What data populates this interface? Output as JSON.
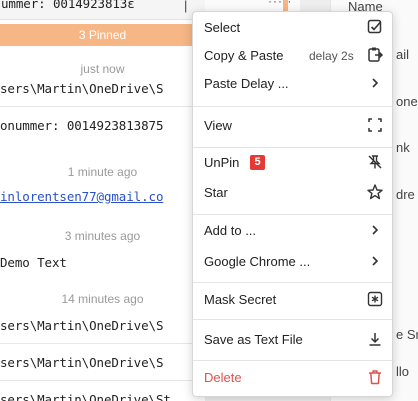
{
  "header": {
    "clip_text": "ummer: 0014923813ε",
    "caret": "|",
    "toolbar_dots": "··· ·"
  },
  "list": {
    "pinned_label": "3 Pinned",
    "items": [
      {
        "time": "just now",
        "text": "sers\\Martin\\OneDrive\\S"
      },
      {
        "text": "onummer: 0014923813875"
      },
      {
        "time": "1 minute ago",
        "text": "inlorentsen77@gmail.co"
      },
      {
        "time": "3 minutes ago",
        "text": " Demo Text"
      },
      {
        "time": "14 minutes ago",
        "text": "sers\\Martin\\OneDrive\\S"
      },
      {
        "text": "sers\\Martin\\OneDrive\\S"
      },
      {
        "text": "sers\\Martin\\OneDrive\\St..."
      }
    ]
  },
  "right_panel": {
    "texts": [
      "Name",
      "ail",
      "one",
      "nk",
      "dre",
      "e Sr",
      "llo"
    ]
  },
  "menu": {
    "items": [
      {
        "label": "Select",
        "icon": "checkbox-checked-icon"
      },
      {
        "label": "Copy & Paste",
        "sub": "delay 2s",
        "icon": "clipboard-arrow-icon"
      },
      {
        "label": "Paste Delay ...",
        "icon": "chevron-right-icon"
      },
      {
        "label": "View",
        "icon": "expand-icon"
      },
      {
        "label": "UnPin",
        "badge": "5",
        "icon": "pin-off-icon"
      },
      {
        "label": "Star",
        "icon": "star-outline-icon"
      },
      {
        "label": "Add to ...",
        "icon": "chevron-right-icon"
      },
      {
        "label": "Google Chrome ...",
        "icon": "chevron-right-icon"
      },
      {
        "label": "Mask Secret",
        "icon": "asterisk-box-icon"
      },
      {
        "label": "Save as Text File",
        "icon": "download-icon"
      },
      {
        "label": "Delete",
        "icon": "trash-icon"
      }
    ]
  },
  "colors": {
    "accent": "#f6b685",
    "danger": "#e0524e",
    "badge": "#e53935",
    "link": "#2b51c9"
  }
}
